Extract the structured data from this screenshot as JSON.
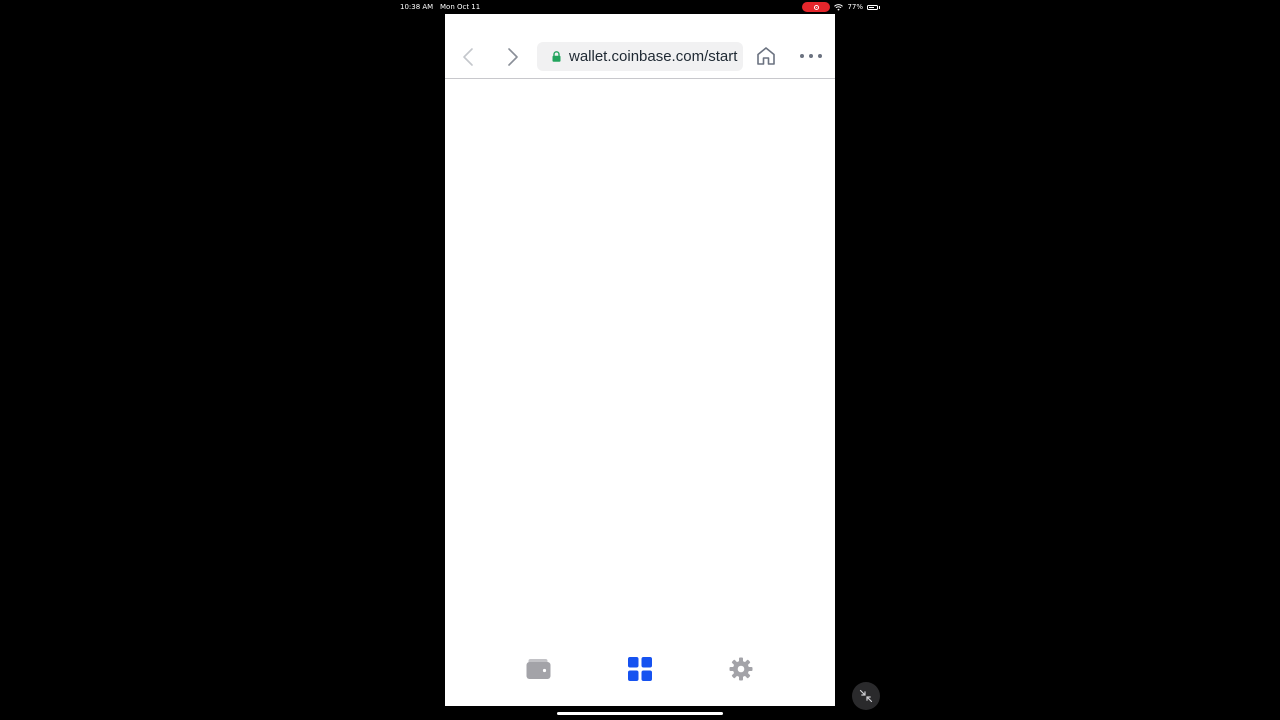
{
  "status_bar": {
    "time": "10:38 AM",
    "date": "Mon Oct 11",
    "battery_text": "77%",
    "battery_level": 0.77,
    "recording_color": "#e5262b"
  },
  "browser": {
    "url": "wallet.coinbase.com/start",
    "lock_color": "#22a45d",
    "icons": {
      "back": "chevron-left-icon",
      "forward": "chevron-right-icon",
      "home": "home-icon",
      "more": "more-horizontal-icon"
    }
  },
  "tabbar": {
    "tabs": [
      {
        "id": "wallet",
        "icon": "wallet-icon",
        "active": false
      },
      {
        "id": "apps",
        "icon": "grid-icon",
        "active": true
      },
      {
        "id": "settings",
        "icon": "gear-icon",
        "active": false
      }
    ],
    "active_color": "#1652f0",
    "inactive_color": "#a3a3a8"
  }
}
